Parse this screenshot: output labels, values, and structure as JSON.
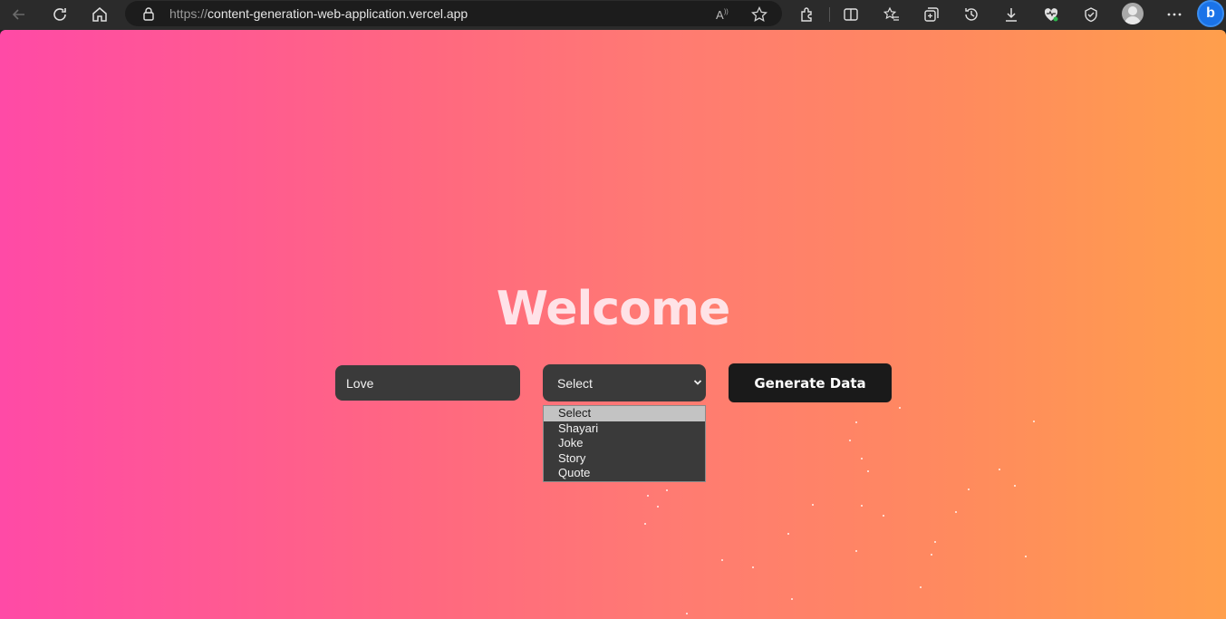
{
  "browser": {
    "url_protocol": "https://",
    "url_host": "content-generation-web-application.vercel.app",
    "icons": [
      "back-icon",
      "refresh-icon",
      "home-icon",
      "lock-icon",
      "read-aloud-icon",
      "favorite-star-icon",
      "extensions-icon",
      "split-screen-icon",
      "favorites-icon",
      "collections-icon",
      "history-icon",
      "downloads-icon",
      "browser-essentials-icon",
      "copilot-shield-icon",
      "profile-icon",
      "more-icon",
      "bing-icon"
    ]
  },
  "page": {
    "title": "Welcome",
    "topic_input_value": "Love",
    "category_select_value": "Select",
    "generate_button_label": "Generate Data",
    "category_options": [
      "Select",
      "Shayari",
      "Joke",
      "Story",
      "Quote"
    ],
    "highlighted_option": "Select"
  },
  "colors": {
    "gradient_start": "#ff4aa6",
    "gradient_end": "#ff9f4c",
    "control_bg": "#3a3a3a",
    "button_bg": "#1a1a1a"
  }
}
